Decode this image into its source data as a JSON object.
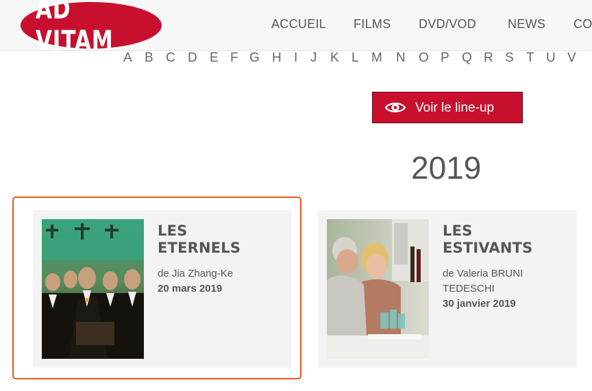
{
  "header": {
    "logo_text": "AD VITAM",
    "nav": [
      "ACCUEIL",
      "FILMS",
      "DVD/VOD",
      "NEWS",
      "CO"
    ]
  },
  "alphabet": [
    "A",
    "B",
    "C",
    "D",
    "E",
    "F",
    "G",
    "H",
    "I",
    "J",
    "K",
    "L",
    "M",
    "N",
    "O",
    "P",
    "Q",
    "R",
    "S",
    "T",
    "U",
    "V"
  ],
  "lineup_button": {
    "label": "Voir le line-up",
    "icon": "eye-icon"
  },
  "year": "2019",
  "films": [
    {
      "title_line1": "LES",
      "title_line2": "ETERNELS",
      "director": "de Jia Zhang-Ke",
      "date": "20 mars 2019"
    },
    {
      "title_line1": "LES",
      "title_line2": "ESTIVANTS",
      "director": "de Valeria BRUNI TEDESCHI",
      "date": "30 janvier 2019"
    }
  ],
  "colors": {
    "brand_red": "#c8102e",
    "highlight": "#e8561e",
    "text": "#555555",
    "card_bg": "#f3f3f3"
  }
}
